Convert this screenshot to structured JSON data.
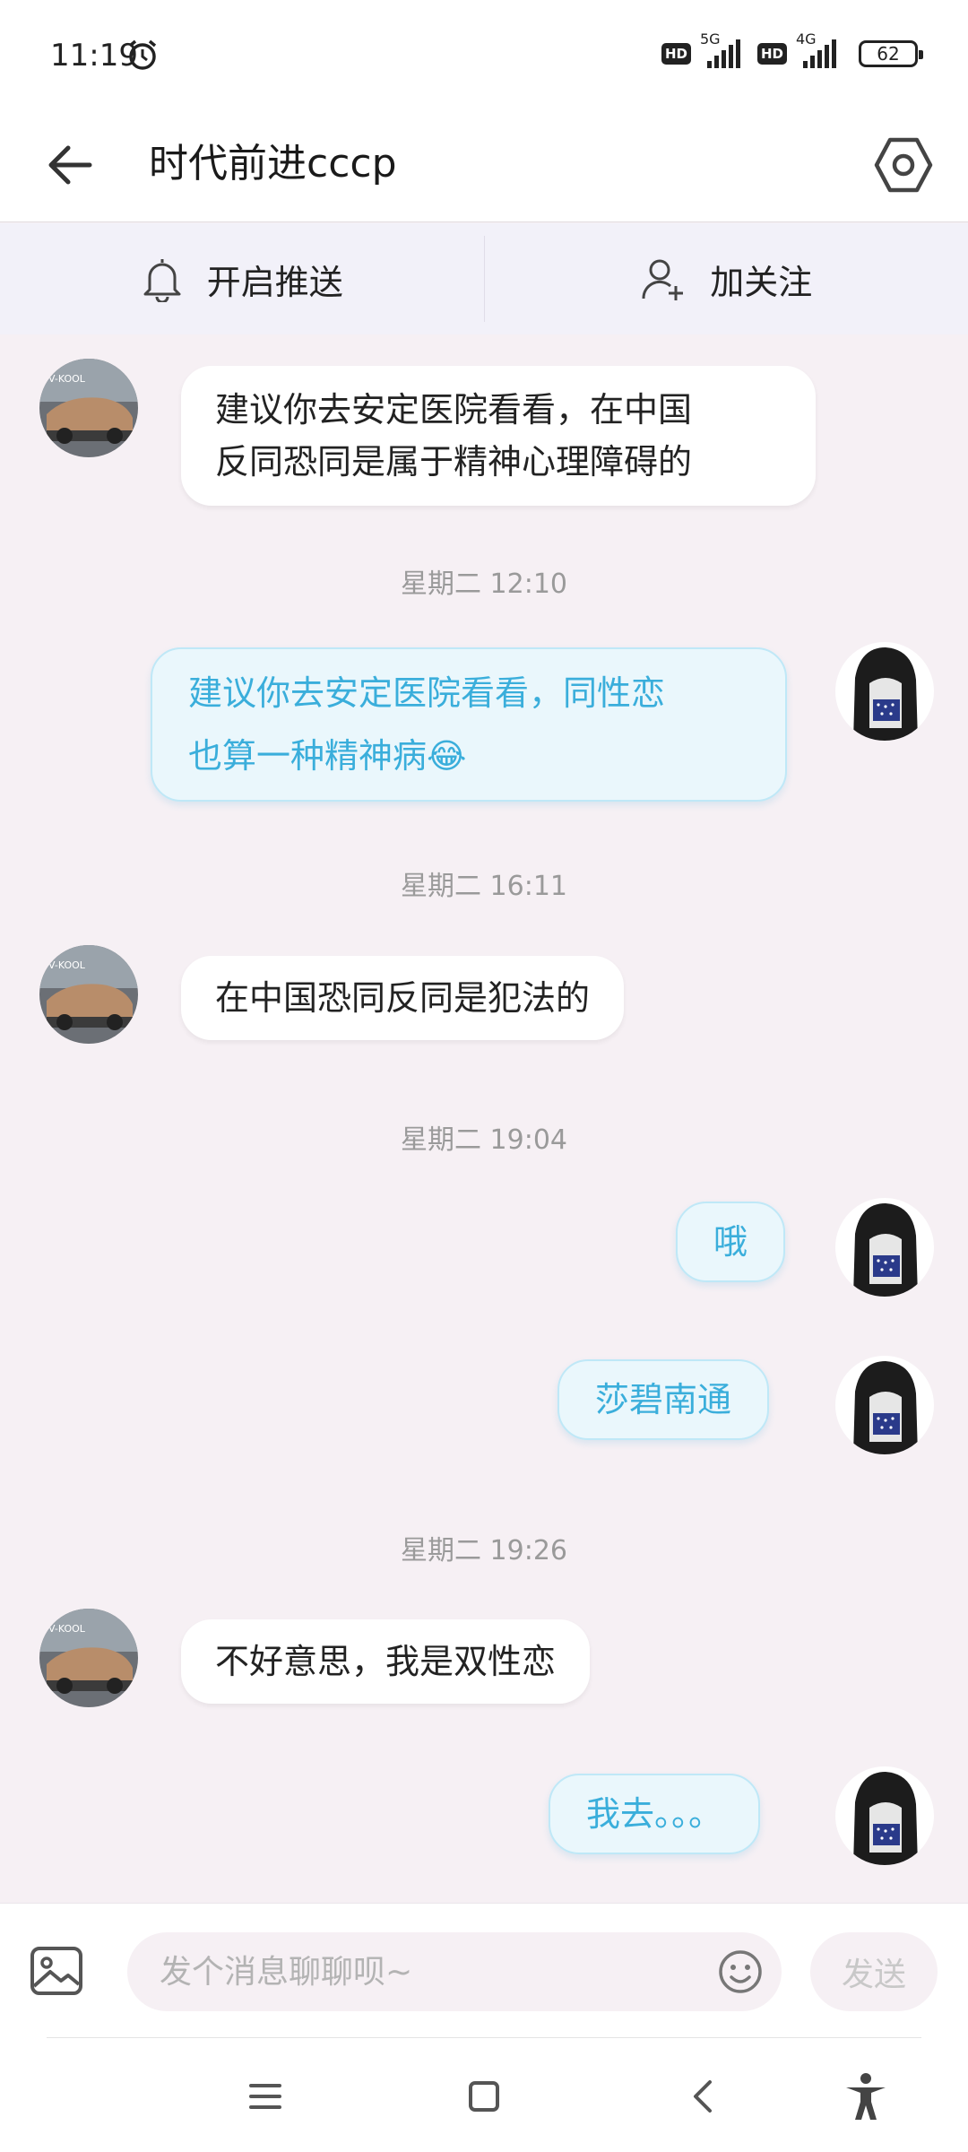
{
  "status_bar": {
    "time": "11:19",
    "hd_label": "HD",
    "network_1": "5G",
    "network_2": "4G",
    "battery": "62"
  },
  "header": {
    "title": "时代前进cccp"
  },
  "actions": {
    "push_label": "开启推送",
    "follow_label": "加关注"
  },
  "messages": [
    {
      "kind": "in",
      "text_lines": [
        "建议你去安定医院看看，在中国",
        "反同恐同是属于精神心理障碍的"
      ]
    },
    {
      "kind": "timestamp",
      "text": "星期二 12:10"
    },
    {
      "kind": "out",
      "text_lines": [
        "建议你去安定医院看看，同性恋",
        "也算一种精神病"
      ],
      "emoji": "😂"
    },
    {
      "kind": "timestamp",
      "text": "星期二 16:11"
    },
    {
      "kind": "in",
      "text": "在中国恐同反同是犯法的"
    },
    {
      "kind": "timestamp",
      "text": "星期二 19:04"
    },
    {
      "kind": "out",
      "text": "哦"
    },
    {
      "kind": "out",
      "text": "莎碧南通"
    },
    {
      "kind": "timestamp",
      "text": "星期二 19:26"
    },
    {
      "kind": "in",
      "text": "不好意思，我是双性恋"
    },
    {
      "kind": "out",
      "text": "我去。。。"
    }
  ],
  "composer": {
    "placeholder": "发个消息聊聊呗~",
    "send_label": "发送"
  },
  "icons": {
    "back": "arrow-left-icon",
    "settings": "hexagon-gear-icon",
    "bell": "bell-icon",
    "add_user": "add-user-icon",
    "image": "image-icon",
    "emoji": "smiley-icon",
    "menu": "menu-icon",
    "home": "square-icon",
    "nav_back": "chevron-left-icon",
    "accessibility": "accessibility-icon"
  },
  "colors": {
    "outgoing_text": "#3aaedb",
    "outgoing_bubble": "#eaf7fc",
    "chat_background": "#f6f0f4",
    "action_bar": "#f2f1f9"
  }
}
